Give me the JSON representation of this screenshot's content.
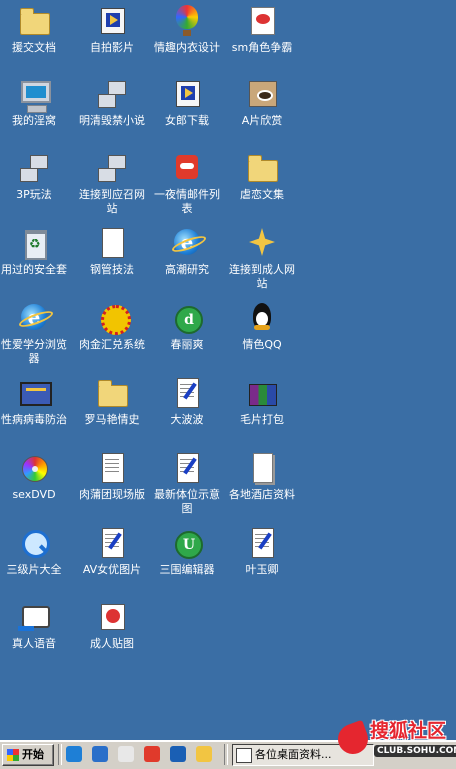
{
  "desktop": {
    "background_color": "#3a6ea5",
    "icons": [
      {
        "label": "援交文档",
        "icon": "folder-icon"
      },
      {
        "label": "自拍影片",
        "icon": "media-player-icon"
      },
      {
        "label": "情趣内衣设计",
        "icon": "balloon-icon"
      },
      {
        "label": "sm角色争霸",
        "icon": "game-icon"
      },
      {
        "label": "我的淫窝",
        "icon": "computer-icon"
      },
      {
        "label": "明清毁禁小说",
        "icon": "network-document-icon"
      },
      {
        "label": "女郎下载",
        "icon": "download-icon"
      },
      {
        "label": "A片欣赏",
        "icon": "eye-image-icon"
      },
      {
        "label": "3P玩法",
        "icon": "network-places-icon"
      },
      {
        "label": "连接到应召网站",
        "icon": "network-connection-icon"
      },
      {
        "label": "一夜情邮件列表",
        "icon": "mail-red-icon"
      },
      {
        "label": "虐恋文集",
        "icon": "folder-icon"
      },
      {
        "label": "用过的安全套",
        "icon": "recycle-bin-icon"
      },
      {
        "label": "钢管技法",
        "icon": "tools-icon"
      },
      {
        "label": "高潮研究",
        "icon": "internet-explorer-icon"
      },
      {
        "label": "连接到成人网站",
        "icon": "connect-sparkle-icon"
      },
      {
        "label": "性爱学分浏览器",
        "icon": "internet-explorer-icon"
      },
      {
        "label": "肉金汇兑系统",
        "icon": "flower-icon"
      },
      {
        "label": "春丽爽",
        "icon": "green-disc-icon"
      },
      {
        "label": "情色QQ",
        "icon": "qq-penguin-icon"
      },
      {
        "label": "性病病毒防治",
        "icon": "program-window-icon"
      },
      {
        "label": "罗马艳情史",
        "icon": "folder-icon"
      },
      {
        "label": "大波波",
        "icon": "document-pen-icon"
      },
      {
        "label": "毛片打包",
        "icon": "books-archive-icon"
      },
      {
        "label": "sexDVD",
        "icon": "cd-icon"
      },
      {
        "label": "肉蒲团现场版",
        "icon": "text-document-icon"
      },
      {
        "label": "最新体位示意图",
        "icon": "document-pen-icon"
      },
      {
        "label": "各地酒店资料",
        "icon": "blank-document-icon"
      },
      {
        "label": "三级片大全",
        "icon": "quicktime-icon"
      },
      {
        "label": "AV女优图片",
        "icon": "document-pen-icon"
      },
      {
        "label": "三围编辑器",
        "icon": "ultraedit-icon"
      },
      {
        "label": "叶玉卿",
        "icon": "document-pen-icon"
      },
      {
        "label": "真人语音",
        "icon": "speaker-tv-icon"
      },
      {
        "label": "成人贴图",
        "icon": "image-stamp-icon"
      }
    ]
  },
  "taskbar": {
    "start_label": "开始",
    "quick_launch": [
      {
        "icon": "internet-explorer-icon",
        "color": "#1e7fd6"
      },
      {
        "icon": "outlook-icon",
        "color": "#2a6fc9"
      },
      {
        "icon": "notepad-icon",
        "color": "#e8e8e8"
      },
      {
        "icon": "red-app-icon",
        "color": "#e03a2b"
      },
      {
        "icon": "ie-alt-icon",
        "color": "#1a5fb4"
      },
      {
        "icon": "media-player-icon",
        "color": "#f2c542"
      }
    ],
    "task_label": "各位桌面资料..."
  },
  "watermark": {
    "title": "搜狐社区",
    "url": "CLUB.SOHU.COM",
    "brand_color": "#e5262f"
  }
}
